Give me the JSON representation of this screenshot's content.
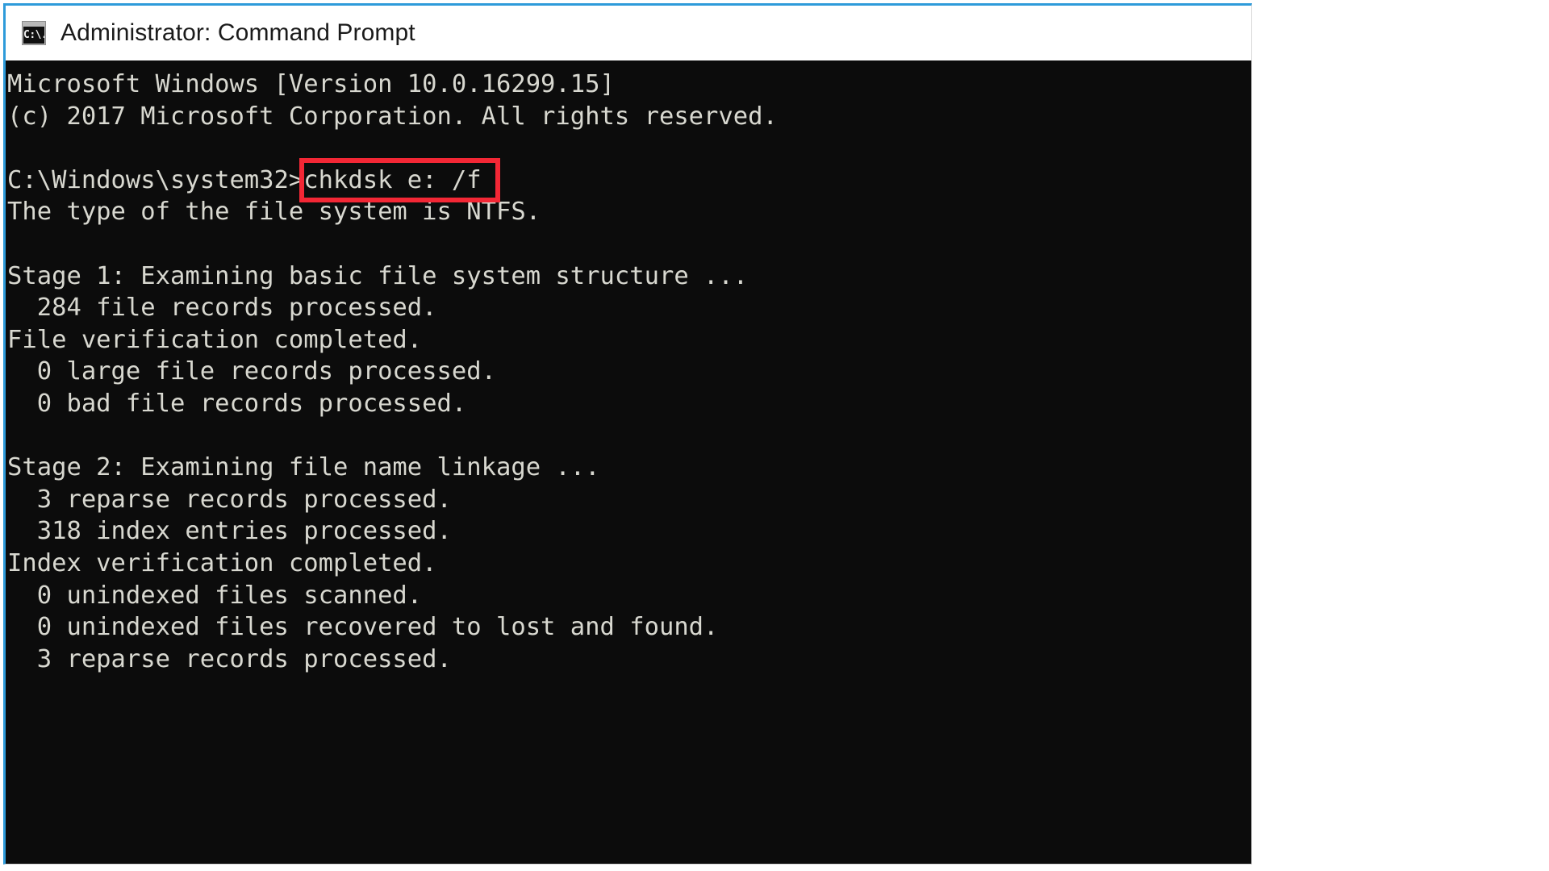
{
  "window": {
    "title": "Administrator: Command Prompt",
    "icon": "command-prompt-icon",
    "icon_glyph": "C:\\.",
    "border_accent_color": "#2e9bda",
    "titlebar_background": "#ffffff",
    "console_background": "#0c0c0c",
    "console_foreground": "#d8d8d0"
  },
  "annotation": {
    "type": "rectangle",
    "color": "#f32735",
    "target_text": "chkdsk e: /f",
    "border_width_px": 6
  },
  "console": {
    "prompt": "C:\\Windows\\system32>",
    "command": "chkdsk e: /f",
    "lines": [
      "Microsoft Windows [Version 10.0.16299.15]",
      "(c) 2017 Microsoft Corporation. All rights reserved.",
      "",
      "C:\\Windows\\system32>chkdsk e: /f",
      "The type of the file system is NTFS.",
      "",
      "Stage 1: Examining basic file system structure ...",
      "  284 file records processed.",
      "File verification completed.",
      "  0 large file records processed.",
      "  0 bad file records processed.",
      "",
      "Stage 2: Examining file name linkage ...",
      "  3 reparse records processed.",
      "  318 index entries processed.",
      "Index verification completed.",
      "  0 unindexed files scanned.",
      "  0 unindexed files recovered to lost and found.",
      "  3 reparse records processed.",
      ""
    ]
  }
}
